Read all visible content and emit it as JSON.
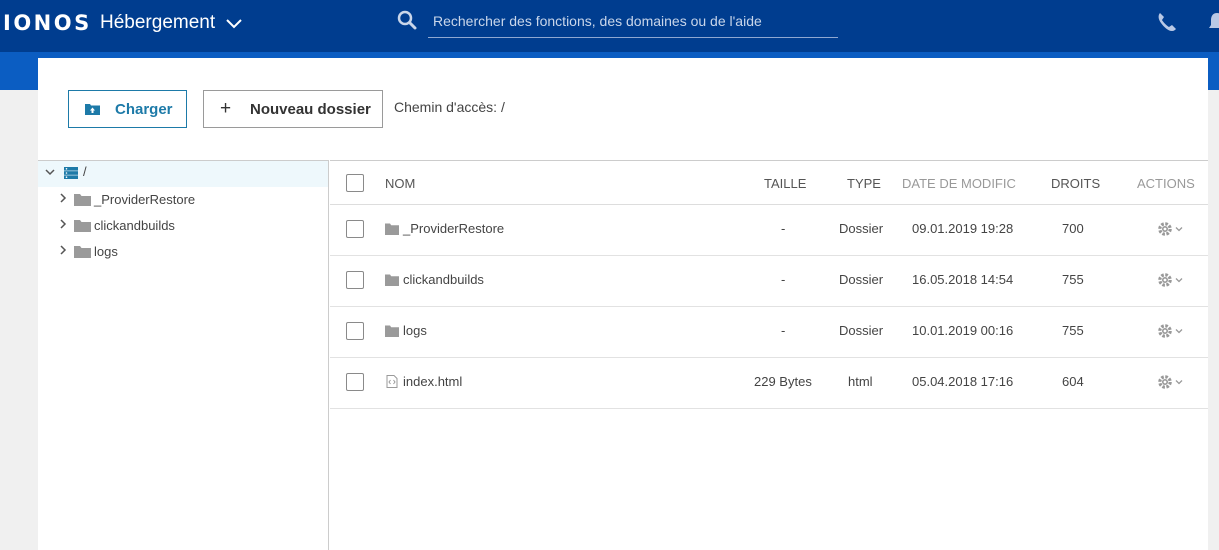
{
  "header": {
    "logo": "IONOS",
    "product": "Hébergement",
    "search_placeholder": "Rechercher des fonctions, des domaines ou de l'aide"
  },
  "toolbar": {
    "upload_label": "Charger",
    "new_folder_label": "Nouveau dossier",
    "path_label": "Chemin d'accès: /"
  },
  "tree": {
    "root_label": "/",
    "items": [
      {
        "label": "_ProviderRestore"
      },
      {
        "label": "clickandbuilds"
      },
      {
        "label": "logs"
      }
    ]
  },
  "table": {
    "columns": {
      "name": "NOM",
      "size": "TAILLE",
      "type": "TYPE",
      "modified": "DATE DE MODIFIC",
      "rights": "DROITS",
      "actions": "ACTIONS"
    },
    "rows": [
      {
        "name": "_ProviderRestore",
        "size": "-",
        "type": "Dossier",
        "modified": "09.01.2019 19:28",
        "rights": "700",
        "icon": "folder-icon"
      },
      {
        "name": "clickandbuilds",
        "size": "-",
        "type": "Dossier",
        "modified": "16.05.2018 14:54",
        "rights": "755",
        "icon": "folder-icon"
      },
      {
        "name": "logs",
        "size": "-",
        "type": "Dossier",
        "modified": "10.01.2019 00:16",
        "rights": "755",
        "icon": "folder-icon"
      },
      {
        "name": "index.html",
        "size": "229 Bytes",
        "type": "html",
        "modified": "05.04.2018 17:16",
        "rights": "604",
        "icon": "file-code-icon"
      }
    ]
  },
  "colors": {
    "header_bg": "#003d8f",
    "subbar_bg": "#0b5dc2",
    "accent": "#1d7aa8"
  }
}
